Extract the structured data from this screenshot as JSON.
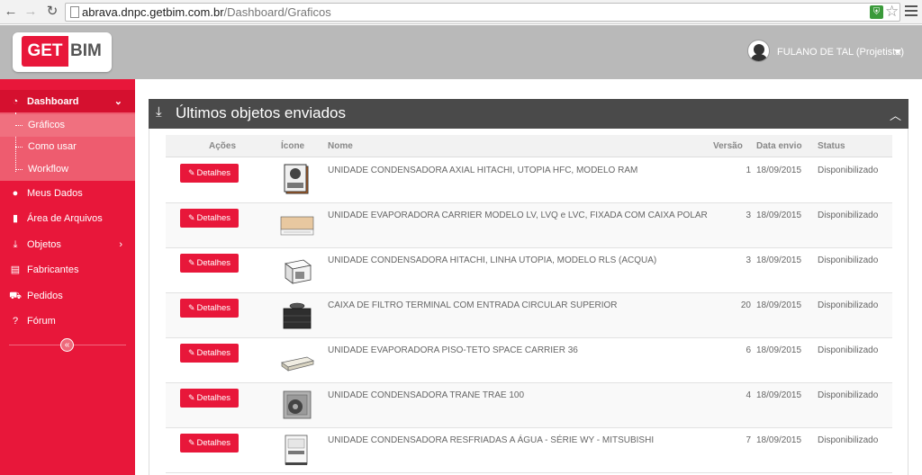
{
  "browser": {
    "url_host": "abrava.dnpc.getbim.com.br",
    "url_path": "/Dashboard/Graficos"
  },
  "header": {
    "logo_get": "GET",
    "logo_bim": "BIM",
    "user_name": "FULANO DE TAL (Projetista)"
  },
  "sidebar": {
    "items": [
      {
        "label": "Dashboard",
        "icon": "dashboard-icon"
      },
      {
        "label": "Meus Dados",
        "icon": "user-icon"
      },
      {
        "label": "Área de Arquivos",
        "icon": "file-icon"
      },
      {
        "label": "Objetos",
        "icon": "download-icon"
      },
      {
        "label": "Fabricantes",
        "icon": "building-icon"
      },
      {
        "label": "Pedidos",
        "icon": "cart-icon"
      },
      {
        "label": "Fórum",
        "icon": "question-icon"
      }
    ],
    "submenu": [
      {
        "label": "Gráficos"
      },
      {
        "label": "Como usar"
      },
      {
        "label": "Workflow"
      }
    ]
  },
  "panel": {
    "title": "Últimos objetos enviados"
  },
  "table": {
    "columns": [
      "Ações",
      "Ícone",
      "Nome",
      "Versão",
      "Data envio",
      "Status"
    ],
    "button_label": "Detalhes",
    "rows": [
      {
        "name": "UNIDADE CONDENSADORA AXIAL HITACHI, UTOPIA HFC, MODELO RAM",
        "version": "1",
        "date": "18/09/2015",
        "status": "Disponibilizado"
      },
      {
        "name": "UNIDADE EVAPORADORA CARRIER MODELO LV, LVQ e LVC, FIXADA COM CAIXA POLAR",
        "version": "3",
        "date": "18/09/2015",
        "status": "Disponibilizado"
      },
      {
        "name": "UNIDADE CONDENSADORA HITACHI, LINHA UTOPIA, MODELO RLS (ACQUA)",
        "version": "3",
        "date": "18/09/2015",
        "status": "Disponibilizado"
      },
      {
        "name": "CAIXA DE FILTRO TERMINAL COM ENTRADA CIRCULAR SUPERIOR",
        "version": "20",
        "date": "18/09/2015",
        "status": "Disponibilizado"
      },
      {
        "name": "UNIDADE EVAPORADORA PISO-TETO SPACE CARRIER 36",
        "version": "6",
        "date": "18/09/2015",
        "status": "Disponibilizado"
      },
      {
        "name": "UNIDADE CONDENSADORA TRANE TRAE 100",
        "version": "4",
        "date": "18/09/2015",
        "status": "Disponibilizado"
      },
      {
        "name": "UNIDADE CONDENSADORA RESFRIADAS A ÁGUA - SÉRIE WY - MITSUBISHI",
        "version": "7",
        "date": "18/09/2015",
        "status": "Disponibilizado"
      }
    ]
  },
  "colors": {
    "brand_red": "#e8173a",
    "panel_dark": "#4a4a4a",
    "header_gray": "#b9b9b9"
  }
}
